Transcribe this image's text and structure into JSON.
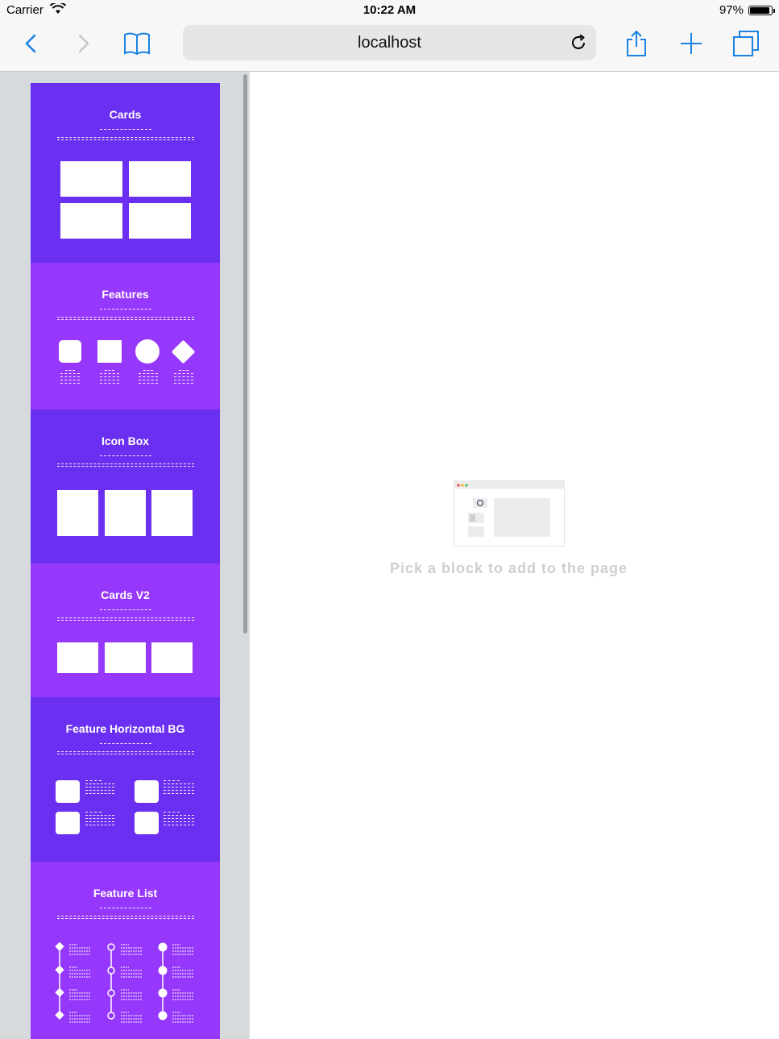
{
  "status_bar": {
    "carrier": "Carrier",
    "time": "10:22 AM",
    "battery": "97%"
  },
  "browser": {
    "url": "localhost"
  },
  "blocks": [
    {
      "title": "Cards"
    },
    {
      "title": "Features"
    },
    {
      "title": "Icon Box"
    },
    {
      "title": "Cards V2"
    },
    {
      "title": "Feature Horizontal BG"
    },
    {
      "title": "Feature List"
    }
  ],
  "canvas": {
    "empty_message": "Pick a block to add to the page"
  },
  "colors": {
    "block_dark": "#6a2ff0",
    "block_light": "#9638fb",
    "accent": "#1a82e2"
  }
}
